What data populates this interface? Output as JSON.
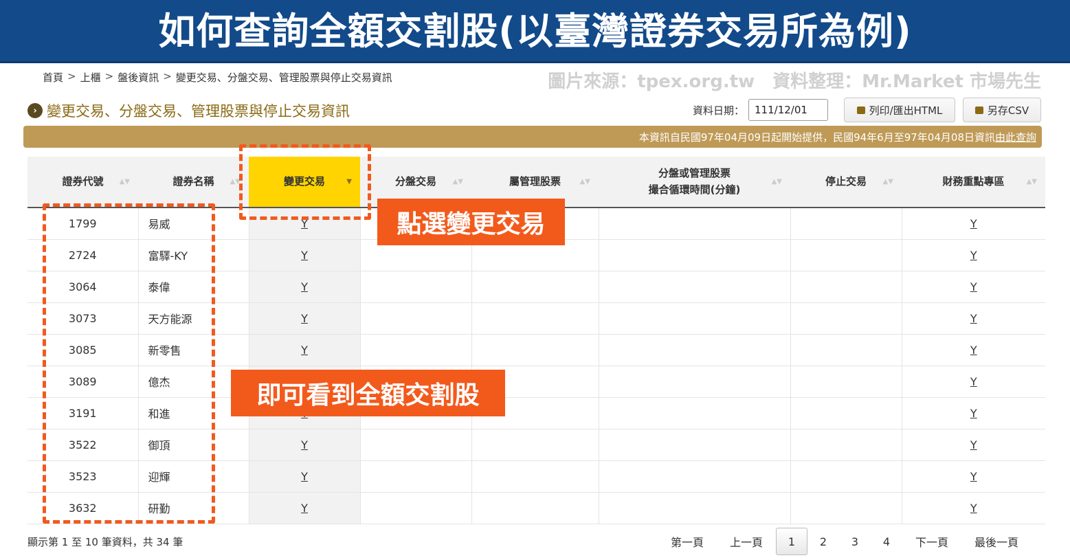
{
  "banner": {
    "title": "如何查詢全額交割股(以臺灣證券交易所為例)"
  },
  "breadcrumb": [
    "首頁",
    "上櫃",
    "盤後資訊",
    "變更交易、分盤交易、管理股票與停止交易資訊"
  ],
  "breadcrumb_separator": ">",
  "source_note": "圖片來源：tpex.org.tw　資料整理：Mr.Market 市場先生",
  "section": {
    "bullet": "›",
    "title": "變更交易、分盤交易、管理股票與停止交易資訊"
  },
  "date_filter": {
    "label": "資料日期：",
    "value": "111/12/01"
  },
  "buttons": {
    "print_html": "列印/匯出HTML",
    "save_csv": "另存CSV"
  },
  "infobar": {
    "text": "本資訊自民國97年04月09日起開始提供，民國94年6月至97年04月08日資訊",
    "link": "由此查詢"
  },
  "table": {
    "headers": {
      "code": "證券代號",
      "name": "證券名稱",
      "change": "變更交易",
      "split": "分盤交易",
      "managed": "屬管理股票",
      "split_time_line1": "分盤或管理股票",
      "split_time_line2": "撮合循環時間(分鐘)",
      "halt": "停止交易",
      "finance": "財務重點專區"
    },
    "sort_icon": "▲▼",
    "active_sort_icon": "▼",
    "rows": [
      {
        "code": "1799",
        "name": "易威",
        "change": "Y",
        "finance": "Y"
      },
      {
        "code": "2724",
        "name": "富驛-KY",
        "change": "Y",
        "finance": "Y"
      },
      {
        "code": "3064",
        "name": "泰偉",
        "change": "Y",
        "finance": "Y"
      },
      {
        "code": "3073",
        "name": "天方能源",
        "change": "Y",
        "finance": "Y"
      },
      {
        "code": "3085",
        "name": "新零售",
        "change": "Y",
        "finance": "Y"
      },
      {
        "code": "3089",
        "name": "億杰",
        "change": "Y",
        "finance": "Y"
      },
      {
        "code": "3191",
        "name": "和進",
        "change": "Y",
        "finance": "Y"
      },
      {
        "code": "3522",
        "name": "御頂",
        "change": "Y",
        "finance": "Y"
      },
      {
        "code": "3523",
        "name": "迎輝",
        "change": "Y",
        "finance": "Y"
      },
      {
        "code": "3632",
        "name": "研勤",
        "change": "Y",
        "finance": "Y"
      }
    ]
  },
  "footer": {
    "count_text": "顯示第 1 至 10 筆資料，共 34 筆"
  },
  "pager": {
    "first": "第一頁",
    "prev": "上一頁",
    "pages": [
      "1",
      "2",
      "3",
      "4"
    ],
    "current": "1",
    "next": "下一頁",
    "last": "最後一頁"
  },
  "annotations": {
    "callout_1": "點選變更交易",
    "callout_2": "即可看到全額交割股"
  },
  "colors": {
    "banner": "#124a8a",
    "infobar": "#bf9a57",
    "active_header": "#ffd400",
    "annotation": "#f25a1c"
  }
}
